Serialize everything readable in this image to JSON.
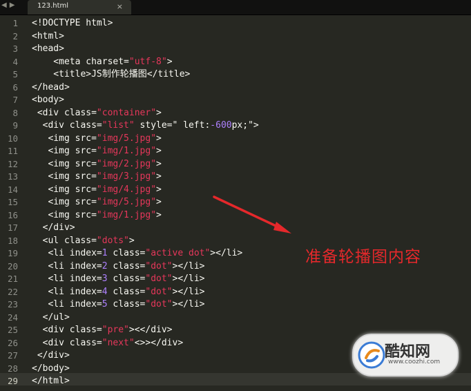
{
  "tab": {
    "filename": "123.html",
    "close": "×"
  },
  "nav": {
    "back": "◀",
    "forward": "▶"
  },
  "line_numbers": [
    "1",
    "2",
    "3",
    "4",
    "5",
    "6",
    "7",
    "8",
    "9",
    "10",
    "11",
    "12",
    "13",
    "14",
    "15",
    "16",
    "17",
    "18",
    "19",
    "20",
    "21",
    "22",
    "23",
    "24",
    "25",
    "26",
    "27",
    "28",
    "29"
  ],
  "code": [
    [
      [
        "t",
        "<!DOCTYPE html>"
      ]
    ],
    [
      [
        "t",
        "<html>"
      ]
    ],
    [
      [
        "t",
        "<head>"
      ]
    ],
    [
      [
        "t",
        "    <meta charset="
      ],
      [
        "s",
        "\"utf-8\""
      ],
      [
        "t",
        ">"
      ]
    ],
    [
      [
        "t",
        "    <title>JS制作轮播图</title>"
      ]
    ],
    [
      [
        "t",
        "</head>"
      ]
    ],
    [
      [
        "t",
        "<body>"
      ]
    ],
    [
      [
        "t",
        " <div class="
      ],
      [
        "s",
        "\"container\""
      ],
      [
        "t",
        ">"
      ]
    ],
    [
      [
        "t",
        "  <div class="
      ],
      [
        "s",
        "\"list\""
      ],
      [
        "t",
        " style=\" left:"
      ],
      [
        "n",
        "-600"
      ],
      [
        "t",
        "px;\">"
      ]
    ],
    [
      [
        "t",
        "   <img src="
      ],
      [
        "s",
        "\"img/5.jpg\""
      ],
      [
        "t",
        ">"
      ]
    ],
    [
      [
        "t",
        "   <img src="
      ],
      [
        "s",
        "\"img/1.jpg\""
      ],
      [
        "t",
        ">"
      ]
    ],
    [
      [
        "t",
        "   <img src="
      ],
      [
        "s",
        "\"img/2.jpg\""
      ],
      [
        "t",
        ">"
      ]
    ],
    [
      [
        "t",
        "   <img src="
      ],
      [
        "s",
        "\"img/3.jpg\""
      ],
      [
        "t",
        ">"
      ]
    ],
    [
      [
        "t",
        "   <img src="
      ],
      [
        "s",
        "\"img/4.jpg\""
      ],
      [
        "t",
        ">"
      ]
    ],
    [
      [
        "t",
        "   <img src="
      ],
      [
        "s",
        "\"img/5.jpg\""
      ],
      [
        "t",
        ">"
      ]
    ],
    [
      [
        "t",
        "   <img src="
      ],
      [
        "s",
        "\"img/1.jpg\""
      ],
      [
        "t",
        ">"
      ]
    ],
    [
      [
        "t",
        "  </div>"
      ]
    ],
    [
      [
        "t",
        "  <ul class="
      ],
      [
        "s",
        "\"dots\""
      ],
      [
        "t",
        ">"
      ]
    ],
    [
      [
        "t",
        "   <li index="
      ],
      [
        "n",
        "1"
      ],
      [
        "t",
        " class="
      ],
      [
        "s",
        "\"active dot\""
      ],
      [
        "t",
        "></li>"
      ]
    ],
    [
      [
        "t",
        "   <li index="
      ],
      [
        "n",
        "2"
      ],
      [
        "t",
        " class="
      ],
      [
        "s",
        "\"dot\""
      ],
      [
        "t",
        "></li>"
      ]
    ],
    [
      [
        "t",
        "   <li index="
      ],
      [
        "n",
        "3"
      ],
      [
        "t",
        " class="
      ],
      [
        "s",
        "\"dot\""
      ],
      [
        "t",
        "></li>"
      ]
    ],
    [
      [
        "t",
        "   <li index="
      ],
      [
        "n",
        "4"
      ],
      [
        "t",
        " class="
      ],
      [
        "s",
        "\"dot\""
      ],
      [
        "t",
        "></li>"
      ]
    ],
    [
      [
        "t",
        "   <li index="
      ],
      [
        "n",
        "5"
      ],
      [
        "t",
        " class="
      ],
      [
        "s",
        "\"dot\""
      ],
      [
        "t",
        "></li>"
      ]
    ],
    [
      [
        "t",
        "  </ul>"
      ]
    ],
    [
      [
        "t",
        "  <div class="
      ],
      [
        "s",
        "\"pre\""
      ],
      [
        "t",
        "><</div>"
      ]
    ],
    [
      [
        "t",
        "  <div class="
      ],
      [
        "s",
        "\"next\""
      ],
      [
        "t",
        "<>></div>"
      ]
    ],
    [
      [
        "t",
        " </div>"
      ]
    ],
    [
      [
        "t",
        "</body>"
      ]
    ],
    [
      [
        "t",
        "</html>"
      ]
    ]
  ],
  "annotation": "准备轮播图内容",
  "watermark": {
    "brand": "酷知网",
    "url": "www.coozhi.com"
  },
  "colors": {
    "background": "#272822",
    "text": "#f8f8f2",
    "string": "#e6375b",
    "number": "#ae81ff",
    "annotation": "#e5282b"
  }
}
